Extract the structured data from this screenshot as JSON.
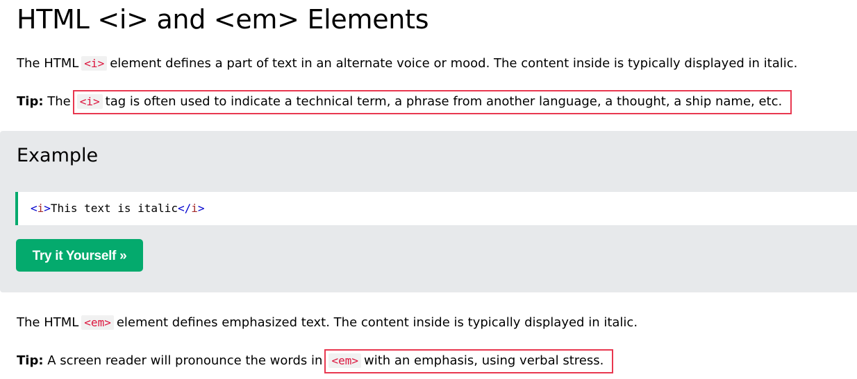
{
  "heading": "HTML <i> and <em> Elements",
  "i_section": {
    "intro_before": "The HTML",
    "intro_tag": "<i>",
    "intro_after": "element defines a part of text in an alternate voice or mood. The content inside is typically displayed in italic.",
    "tip_label": "Tip:",
    "tip_before": "The",
    "tip_tag": "<i>",
    "tip_after": "tag is often used to indicate a technical term, a phrase from another language, a thought, a ship name, etc."
  },
  "example": {
    "title": "Example",
    "code_open_lt": "<",
    "code_open_name": "i",
    "code_open_gt": ">",
    "code_text": "This text is italic",
    "code_close_lt": "</",
    "code_close_name": "i",
    "code_close_gt": ">",
    "button_label": "Try it Yourself »"
  },
  "em_section": {
    "intro_before": "The HTML",
    "intro_tag": "<em>",
    "intro_after": "element defines emphasized text. The content inside is typically displayed in italic.",
    "tip_label": "Tip:",
    "tip_before": "A screen reader will pronounce the words in",
    "tip_tag": "<em>",
    "tip_after": "with an emphasis, using verbal stress."
  },
  "colors": {
    "accent_green": "#04aa6d",
    "tag_red": "#dc143c",
    "highlight_border": "#e8374f",
    "example_bg": "#e7e9eb"
  }
}
